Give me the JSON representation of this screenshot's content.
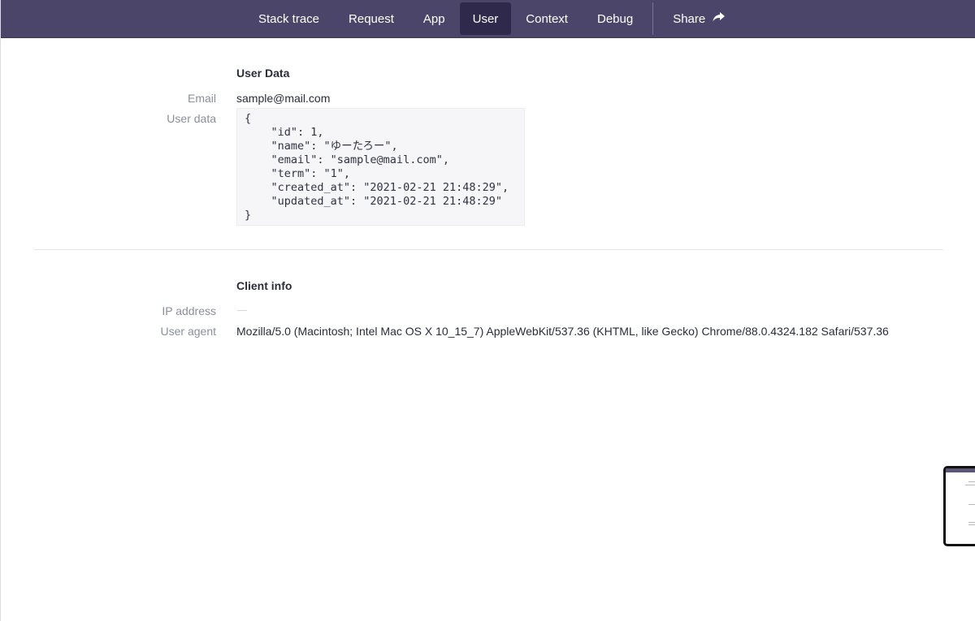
{
  "nav": {
    "tabs": [
      {
        "label": "Stack trace"
      },
      {
        "label": "Request"
      },
      {
        "label": "App"
      },
      {
        "label": "User"
      },
      {
        "label": "Context"
      },
      {
        "label": "Debug"
      }
    ],
    "active_tab": "User",
    "share_label": "Share"
  },
  "user_section": {
    "title": "User Data",
    "email_label": "Email",
    "email_value": "sample@mail.com",
    "user_data_label": "User data",
    "user_data_json": "{\n    \"id\": 1,\n    \"name\": \"ゆーたろー\",\n    \"email\": \"sample@mail.com\",\n    \"term\": \"1\",\n    \"created_at\": \"2021-02-21 21:48:29\",\n    \"updated_at\": \"2021-02-21 21:48:29\"\n}"
  },
  "client_section": {
    "title": "Client info",
    "ip_label": "IP address",
    "user_agent_label": "User agent",
    "user_agent_value": "Mozilla/5.0 (Macintosh; Intel Mac OS X 10_15_7) AppleWebKit/537.36 (KHTML, like Gecko) Chrome/88.0.4324.182 Safari/537.36"
  },
  "colors": {
    "nav_bg": "#4b4669",
    "nav_active": "#2f2a4b",
    "label": "#8a8f9c",
    "text": "#2a2d3a"
  },
  "icons": {
    "share": "share-arrow-icon"
  }
}
